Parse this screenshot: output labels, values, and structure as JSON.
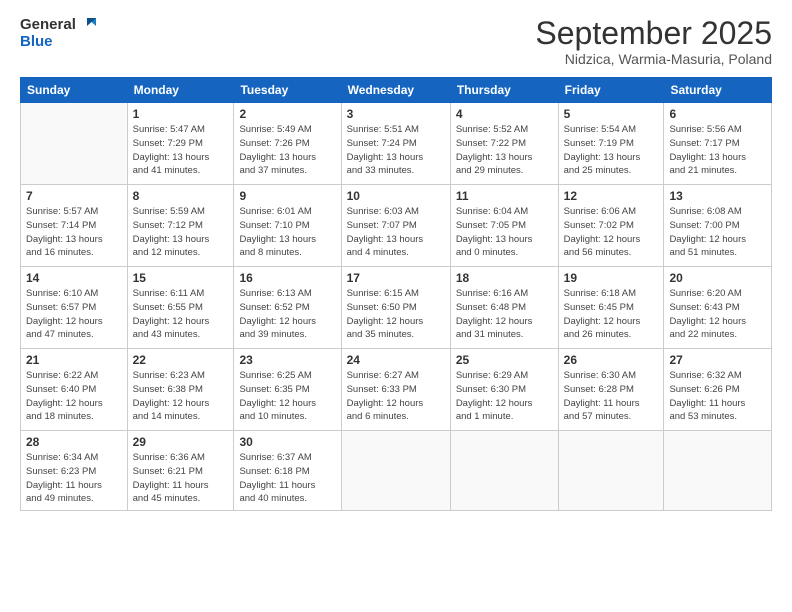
{
  "header": {
    "logo_line1": "General",
    "logo_line2": "Blue",
    "month_title": "September 2025",
    "subtitle": "Nidzica, Warmia-Masuria, Poland"
  },
  "weekdays": [
    "Sunday",
    "Monday",
    "Tuesday",
    "Wednesday",
    "Thursday",
    "Friday",
    "Saturday"
  ],
  "weeks": [
    [
      {
        "day": "",
        "info": ""
      },
      {
        "day": "1",
        "info": "Sunrise: 5:47 AM\nSunset: 7:29 PM\nDaylight: 13 hours\nand 41 minutes."
      },
      {
        "day": "2",
        "info": "Sunrise: 5:49 AM\nSunset: 7:26 PM\nDaylight: 13 hours\nand 37 minutes."
      },
      {
        "day": "3",
        "info": "Sunrise: 5:51 AM\nSunset: 7:24 PM\nDaylight: 13 hours\nand 33 minutes."
      },
      {
        "day": "4",
        "info": "Sunrise: 5:52 AM\nSunset: 7:22 PM\nDaylight: 13 hours\nand 29 minutes."
      },
      {
        "day": "5",
        "info": "Sunrise: 5:54 AM\nSunset: 7:19 PM\nDaylight: 13 hours\nand 25 minutes."
      },
      {
        "day": "6",
        "info": "Sunrise: 5:56 AM\nSunset: 7:17 PM\nDaylight: 13 hours\nand 21 minutes."
      }
    ],
    [
      {
        "day": "7",
        "info": "Sunrise: 5:57 AM\nSunset: 7:14 PM\nDaylight: 13 hours\nand 16 minutes."
      },
      {
        "day": "8",
        "info": "Sunrise: 5:59 AM\nSunset: 7:12 PM\nDaylight: 13 hours\nand 12 minutes."
      },
      {
        "day": "9",
        "info": "Sunrise: 6:01 AM\nSunset: 7:10 PM\nDaylight: 13 hours\nand 8 minutes."
      },
      {
        "day": "10",
        "info": "Sunrise: 6:03 AM\nSunset: 7:07 PM\nDaylight: 13 hours\nand 4 minutes."
      },
      {
        "day": "11",
        "info": "Sunrise: 6:04 AM\nSunset: 7:05 PM\nDaylight: 13 hours\nand 0 minutes."
      },
      {
        "day": "12",
        "info": "Sunrise: 6:06 AM\nSunset: 7:02 PM\nDaylight: 12 hours\nand 56 minutes."
      },
      {
        "day": "13",
        "info": "Sunrise: 6:08 AM\nSunset: 7:00 PM\nDaylight: 12 hours\nand 51 minutes."
      }
    ],
    [
      {
        "day": "14",
        "info": "Sunrise: 6:10 AM\nSunset: 6:57 PM\nDaylight: 12 hours\nand 47 minutes."
      },
      {
        "day": "15",
        "info": "Sunrise: 6:11 AM\nSunset: 6:55 PM\nDaylight: 12 hours\nand 43 minutes."
      },
      {
        "day": "16",
        "info": "Sunrise: 6:13 AM\nSunset: 6:52 PM\nDaylight: 12 hours\nand 39 minutes."
      },
      {
        "day": "17",
        "info": "Sunrise: 6:15 AM\nSunset: 6:50 PM\nDaylight: 12 hours\nand 35 minutes."
      },
      {
        "day": "18",
        "info": "Sunrise: 6:16 AM\nSunset: 6:48 PM\nDaylight: 12 hours\nand 31 minutes."
      },
      {
        "day": "19",
        "info": "Sunrise: 6:18 AM\nSunset: 6:45 PM\nDaylight: 12 hours\nand 26 minutes."
      },
      {
        "day": "20",
        "info": "Sunrise: 6:20 AM\nSunset: 6:43 PM\nDaylight: 12 hours\nand 22 minutes."
      }
    ],
    [
      {
        "day": "21",
        "info": "Sunrise: 6:22 AM\nSunset: 6:40 PM\nDaylight: 12 hours\nand 18 minutes."
      },
      {
        "day": "22",
        "info": "Sunrise: 6:23 AM\nSunset: 6:38 PM\nDaylight: 12 hours\nand 14 minutes."
      },
      {
        "day": "23",
        "info": "Sunrise: 6:25 AM\nSunset: 6:35 PM\nDaylight: 12 hours\nand 10 minutes."
      },
      {
        "day": "24",
        "info": "Sunrise: 6:27 AM\nSunset: 6:33 PM\nDaylight: 12 hours\nand 6 minutes."
      },
      {
        "day": "25",
        "info": "Sunrise: 6:29 AM\nSunset: 6:30 PM\nDaylight: 12 hours\nand 1 minute."
      },
      {
        "day": "26",
        "info": "Sunrise: 6:30 AM\nSunset: 6:28 PM\nDaylight: 11 hours\nand 57 minutes."
      },
      {
        "day": "27",
        "info": "Sunrise: 6:32 AM\nSunset: 6:26 PM\nDaylight: 11 hours\nand 53 minutes."
      }
    ],
    [
      {
        "day": "28",
        "info": "Sunrise: 6:34 AM\nSunset: 6:23 PM\nDaylight: 11 hours\nand 49 minutes."
      },
      {
        "day": "29",
        "info": "Sunrise: 6:36 AM\nSunset: 6:21 PM\nDaylight: 11 hours\nand 45 minutes."
      },
      {
        "day": "30",
        "info": "Sunrise: 6:37 AM\nSunset: 6:18 PM\nDaylight: 11 hours\nand 40 minutes."
      },
      {
        "day": "",
        "info": ""
      },
      {
        "day": "",
        "info": ""
      },
      {
        "day": "",
        "info": ""
      },
      {
        "day": "",
        "info": ""
      }
    ]
  ]
}
